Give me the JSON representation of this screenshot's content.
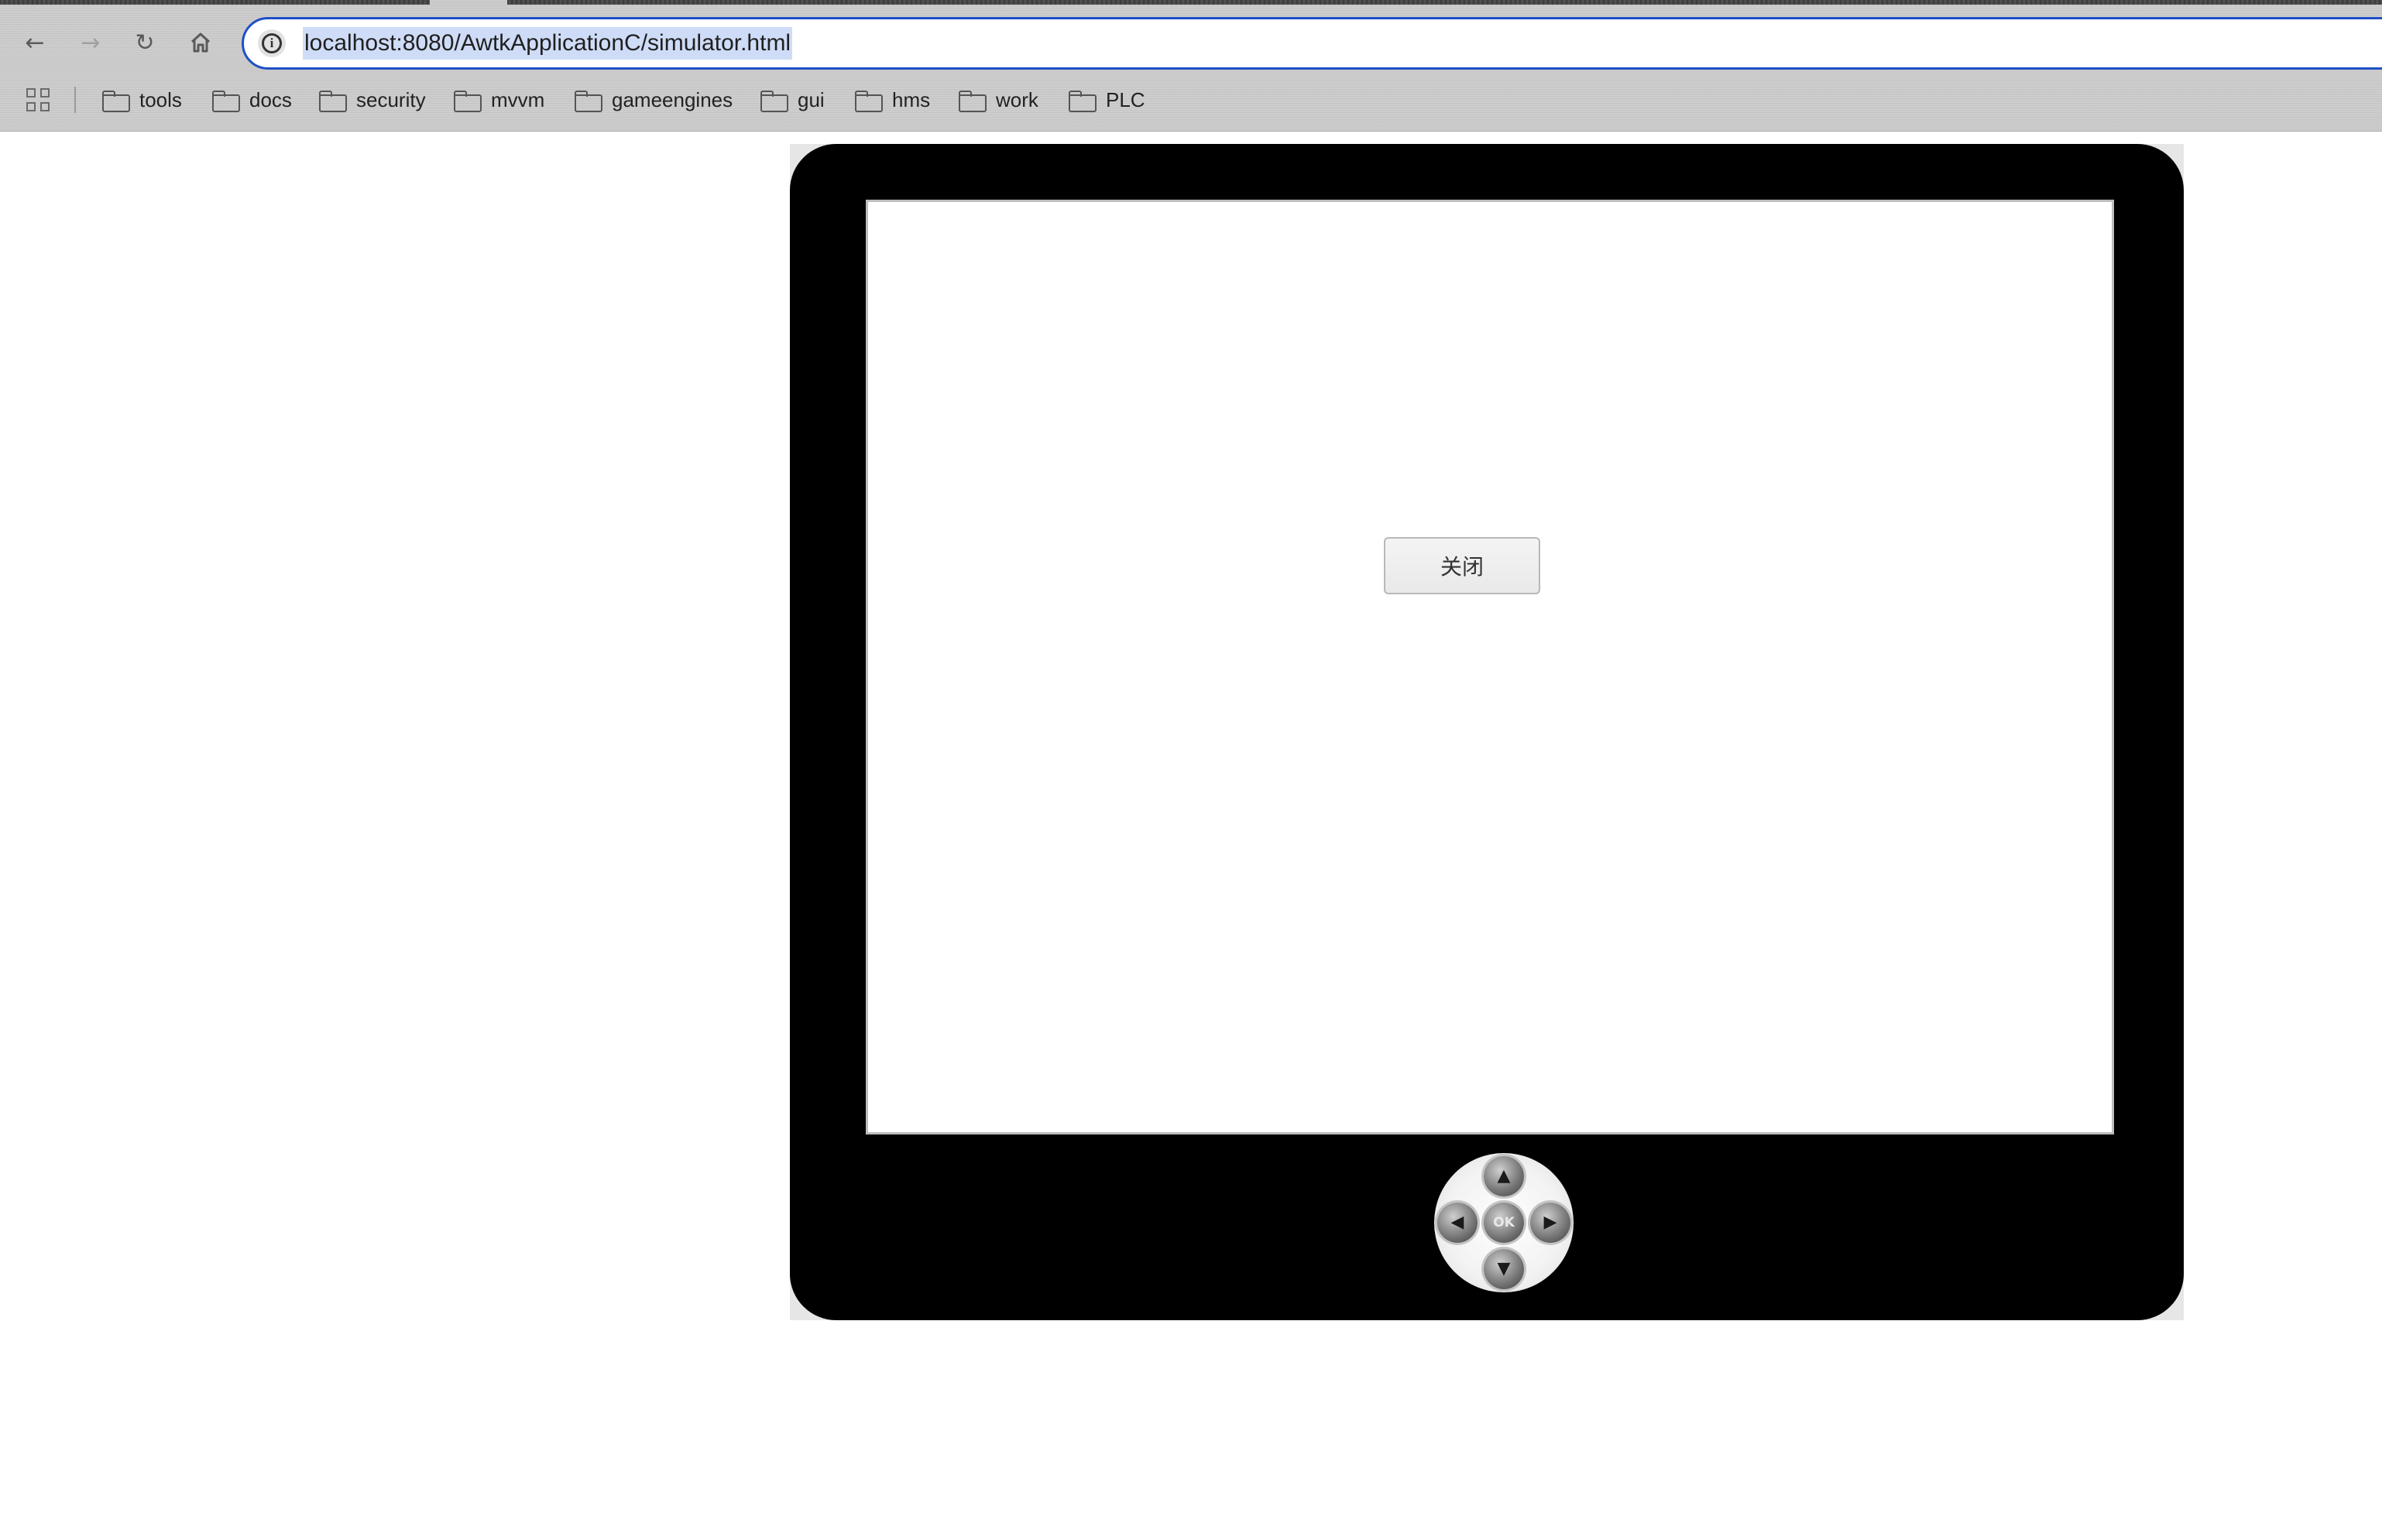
{
  "browser": {
    "nav": {
      "back_icon": "arrow-left-icon",
      "forward_icon": "arrow-right-icon",
      "reload_icon": "reload-icon",
      "home_icon": "home-icon"
    },
    "address_bar": {
      "info_icon": "info-icon",
      "url": "localhost:8080/AwtkApplicationC/simulator.html",
      "accent_color": "#1f4fc7"
    },
    "bookmarks": {
      "apps_icon": "apps-grid-icon",
      "items": [
        {
          "label": "tools",
          "icon": "folder-icon"
        },
        {
          "label": "docs",
          "icon": "folder-icon"
        },
        {
          "label": "security",
          "icon": "folder-icon"
        },
        {
          "label": "mvvm",
          "icon": "folder-icon"
        },
        {
          "label": "gameengines",
          "icon": "folder-icon"
        },
        {
          "label": "gui",
          "icon": "folder-icon"
        },
        {
          "label": "hms",
          "icon": "folder-icon"
        },
        {
          "label": "work",
          "icon": "folder-icon"
        },
        {
          "label": "PLC",
          "icon": "folder-icon"
        }
      ]
    }
  },
  "simulator": {
    "screen": {
      "close_button_label": "关闭"
    },
    "dpad": {
      "up_icon": "arrow-up-icon",
      "down_icon": "arrow-down-icon",
      "left_icon": "arrow-left-icon",
      "right_icon": "arrow-right-icon",
      "ok_label": "OK"
    },
    "bezel_color": "#000000"
  }
}
